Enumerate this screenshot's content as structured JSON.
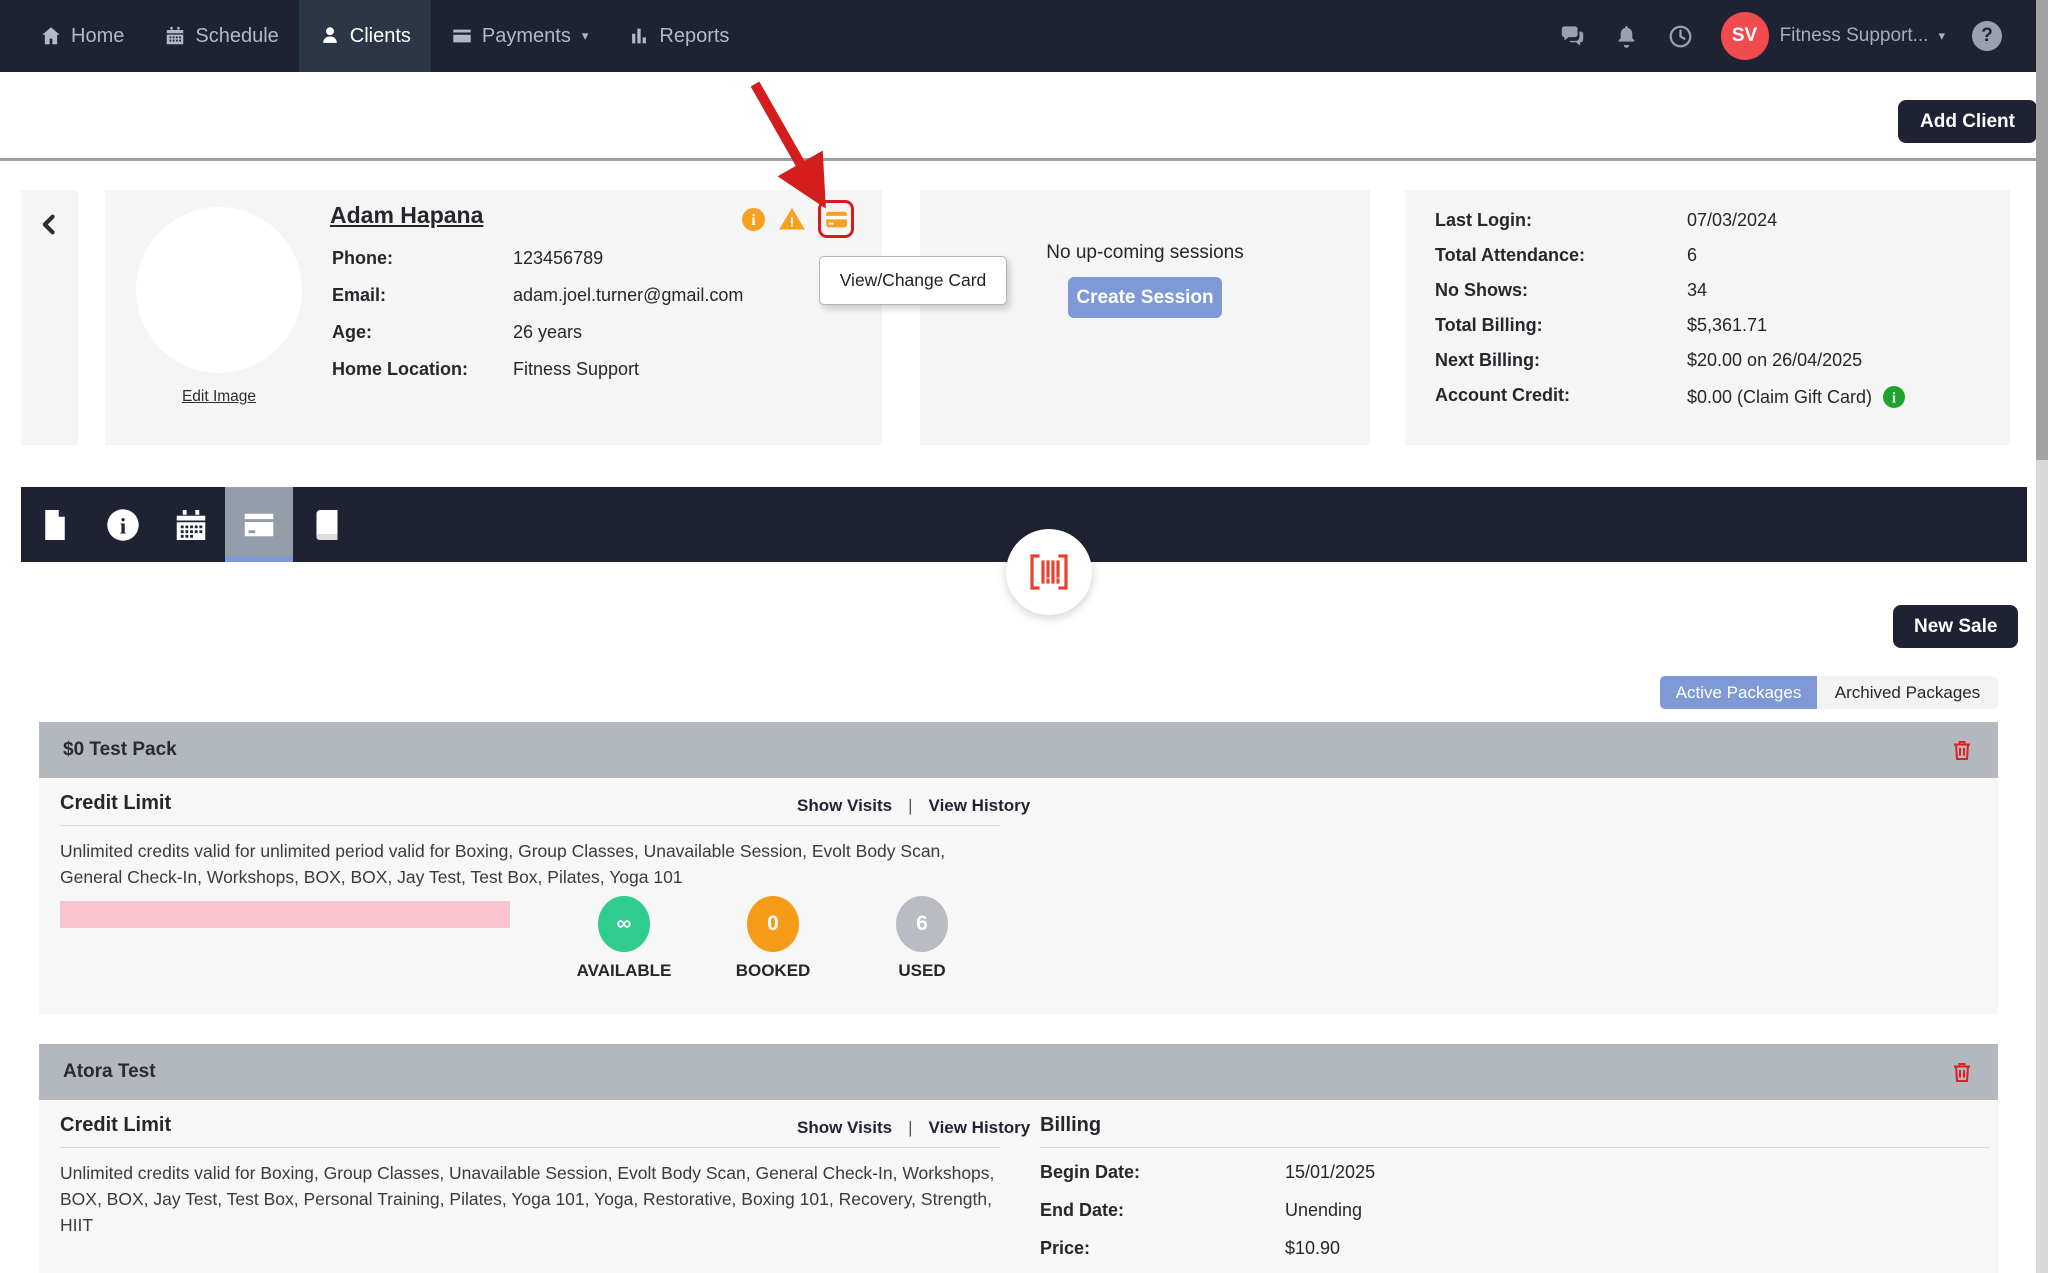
{
  "nav": {
    "items": [
      {
        "label": "Home",
        "icon": "home-icon",
        "active": false
      },
      {
        "label": "Schedule",
        "icon": "calendar-icon",
        "active": false
      },
      {
        "label": "Clients",
        "icon": "person-icon",
        "active": true
      },
      {
        "label": "Payments",
        "icon": "card-icon",
        "active": false,
        "has_caret": true
      },
      {
        "label": "Reports",
        "icon": "bar-chart-icon",
        "active": false
      }
    ],
    "right": {
      "icons": [
        "chat-icon",
        "bell-icon",
        "clock-icon"
      ],
      "avatar_initials": "SV",
      "account_label": "Fitness Support...",
      "help_icon": "question-icon"
    }
  },
  "header": {
    "add_client_label": "Add Client"
  },
  "profile": {
    "name": "Adam Hapana",
    "edit_image_label": "Edit Image",
    "status_icons": [
      "info-icon",
      "warning-icon",
      "credit-card-icon"
    ],
    "tooltip": "View/Change Card",
    "fields": [
      {
        "label": "Phone:",
        "value": "123456789"
      },
      {
        "label": "Email:",
        "value": "adam.joel.turner@gmail.com"
      },
      {
        "label": "Age:",
        "value": "26 years"
      },
      {
        "label": "Home Location:",
        "value": "Fitness Support"
      }
    ]
  },
  "sessions": {
    "empty_text": "No up-coming sessions",
    "create_button_label": "Create Session"
  },
  "stats": {
    "rows": [
      {
        "label": "Last Login:",
        "value": "07/03/2024"
      },
      {
        "label": "Total Attendance:",
        "value": "6"
      },
      {
        "label": "No Shows:",
        "value": "34"
      },
      {
        "label": "Total Billing:",
        "value": "$5,361.71"
      },
      {
        "label": "Next Billing:",
        "value": "$20.00 on 26/04/2025"
      },
      {
        "label": "Account Credit:",
        "value": "$0.00 (Claim Gift Card)",
        "has_info_icon": true
      }
    ]
  },
  "tabs": {
    "items": [
      {
        "icon": "file-icon",
        "active": false
      },
      {
        "icon": "info-icon",
        "active": false
      },
      {
        "icon": "calendar-icon",
        "active": false
      },
      {
        "icon": "credit-card-icon",
        "active": true
      },
      {
        "icon": "book-icon",
        "active": false
      }
    ],
    "badge_icon": "barcode-icon"
  },
  "packages": {
    "new_sale_label": "New Sale",
    "toggle": {
      "active_label": "Active Packages",
      "archived_label": "Archived Packages"
    },
    "links": {
      "show_visits": "Show Visits",
      "divider": "|",
      "view_history": "View History"
    },
    "sections": [
      {
        "title": "$0 Test Pack",
        "heading": "Credit Limit",
        "description": "Unlimited credits valid for unlimited period valid for Boxing, Group Classes, Unavailable Session, Evolt Body Scan, General Check-In, Workshops, BOX, BOX, Jay Test, Test Box, Pilates, Yoga 101",
        "counters": [
          {
            "value": "∞",
            "label": "AVAILABLE",
            "color": "#2ecc8f"
          },
          {
            "value": "0",
            "label": "BOOKED",
            "color": "#f59b18"
          },
          {
            "value": "6",
            "label": "USED",
            "color": "#b9bcc3"
          }
        ]
      },
      {
        "title": "Atora Test",
        "heading": "Credit Limit",
        "description": "Unlimited credits valid for Boxing, Group Classes, Unavailable Session, Evolt Body Scan, General Check-In, Workshops, BOX, BOX, Jay Test, Test Box, Personal Training, Pilates, Yoga 101, Yoga, Restorative, Boxing 101, Recovery, Strength, HIIT",
        "billing": {
          "heading": "Billing",
          "rows": [
            {
              "label": "Begin Date:",
              "value": "15/01/2025"
            },
            {
              "label": "End Date:",
              "value": "Unending"
            },
            {
              "label": "Price:",
              "value": "$10.90"
            }
          ]
        }
      }
    ]
  },
  "colors": {
    "navbar": "#1e2233",
    "accent_blue": "#7e99d5",
    "alert_orange": "#f5a01e",
    "highlight_red": "#d41d1d",
    "success_green": "#2ecc8f",
    "booked_orange": "#f59b18",
    "used_gray": "#b9bcc3",
    "header_gray": "#b3b7be",
    "pink_bar": "#f9c3cf",
    "avatar_red": "#f04b4e",
    "gift_info_green": "#1fa32c"
  }
}
